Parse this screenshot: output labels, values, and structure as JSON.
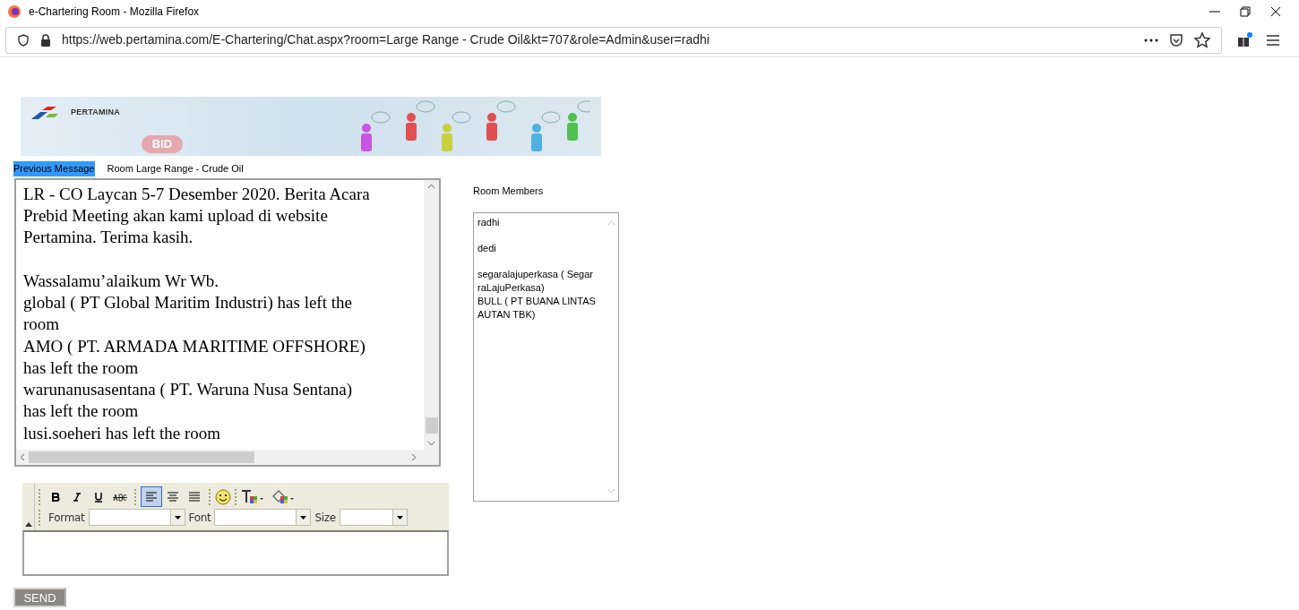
{
  "window": {
    "title": "e-Chartering Room - Mozilla Firefox"
  },
  "address_bar": {
    "url": "https://web.pertamina.com/E-Chartering/Chat.aspx?room=Large Range - Crude Oil&kt=707&role=Admin&user=radhi"
  },
  "banner": {
    "brand": "PERTAMINA",
    "badge": "BID"
  },
  "header": {
    "previous_link": "Previous Message",
    "room_title": "Room Large Range - Crude Oil"
  },
  "chat": {
    "paragraphs": [
      [
        "LR - CO Laycan 5-7 Desember 2020. Berita Acara",
        "Prebid Meeting akan kami upload di website",
        "Pertamina. Terima kasih."
      ],
      [
        "Wassalamu’alaikum Wr Wb.",
        "global ( PT Global Maritim Industri) has left the",
        "room",
        "AMO ( PT. ARMADA MARITIME OFFSHORE)",
        "has left the room",
        "warunanusasentana ( PT. Waruna Nusa Sentana)",
        "has left the room",
        "lusi.soeheri has left the room"
      ]
    ]
  },
  "members": {
    "title": "Room Members",
    "groups": [
      [
        {
          "lines": [
            "radhi"
          ]
        }
      ],
      [
        {
          "lines": [
            "dedi"
          ]
        }
      ],
      [
        {
          "lines": [
            "segaralajuperkasa ( Segar",
            "raLajuPerkasa)"
          ]
        },
        {
          "lines": [
            "BULL ( PT BUANA LINTAS",
            "AUTAN TBK)"
          ]
        }
      ]
    ]
  },
  "editor": {
    "tools": [
      {
        "kind": "bold",
        "selected": false
      },
      {
        "kind": "italic",
        "selected": false
      },
      {
        "kind": "underline",
        "selected": false
      },
      {
        "kind": "strike",
        "selected": false
      },
      {
        "kind": "align-left",
        "selected": true
      },
      {
        "kind": "align-center",
        "selected": false
      },
      {
        "kind": "justify",
        "selected": false
      }
    ],
    "format_label": "Format",
    "font_label": "Font",
    "size_label": "Size"
  },
  "send_button": "SEND"
}
